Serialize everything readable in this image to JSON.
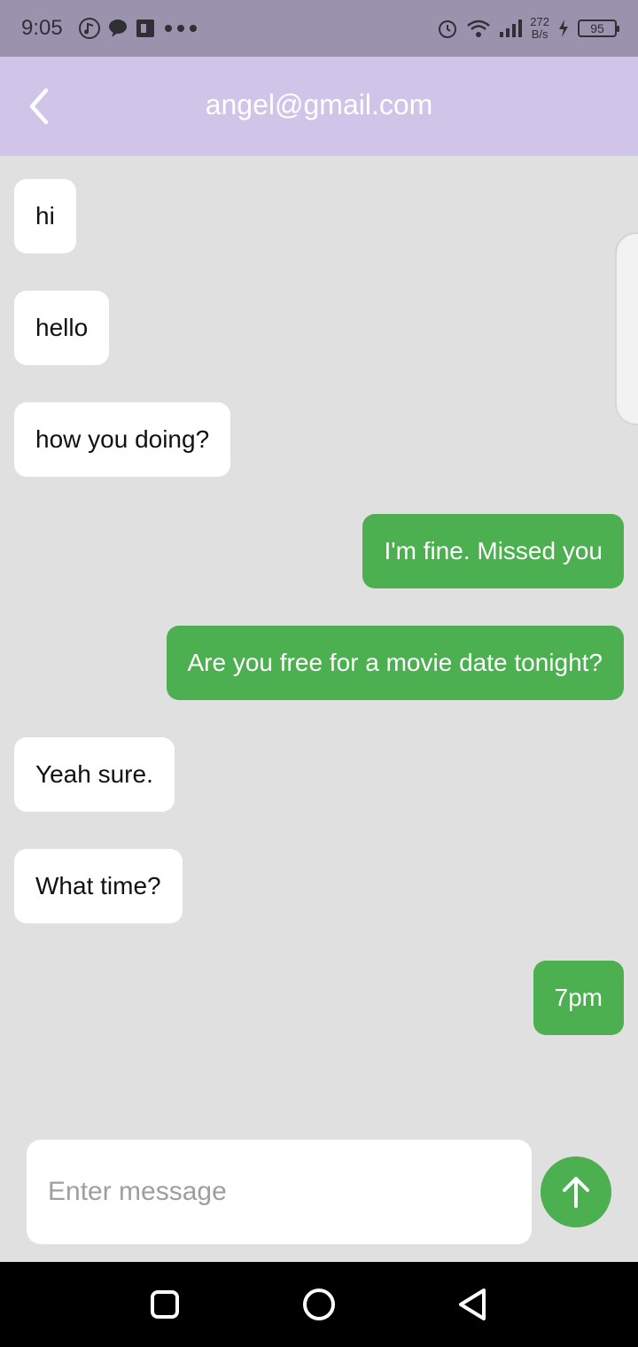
{
  "status_bar": {
    "time": "9:05",
    "net_speed_value": "272",
    "net_speed_unit": "B/s",
    "battery": "95",
    "icons_left": [
      "music-note-icon",
      "chat-bubble-icon",
      "app-icon",
      "more-dots-icon"
    ],
    "icons_right": [
      "alarm-icon",
      "wifi-icon",
      "signal-icon",
      "charging-icon",
      "battery-icon"
    ]
  },
  "app_bar": {
    "title": "angel@gmail.com",
    "back_icon": "chevron-left-icon",
    "background_color": "#d0c4e8"
  },
  "messages": [
    {
      "text": "hi",
      "from": "other"
    },
    {
      "text": "hello",
      "from": "other"
    },
    {
      "text": "how you doing?",
      "from": "other"
    },
    {
      "text": "I'm fine. Missed you",
      "from": "me"
    },
    {
      "text": "Are you free for a movie date tonight?",
      "from": "me"
    },
    {
      "text": "Yeah sure.",
      "from": "other"
    },
    {
      "text": "What time?",
      "from": "other"
    },
    {
      "text": "7pm",
      "from": "me"
    }
  ],
  "composer": {
    "placeholder": "Enter message",
    "value": "",
    "send_icon": "arrow-up-icon",
    "accent_color": "#4caf50"
  },
  "nav_bar": {
    "icons": [
      "recent-apps-icon",
      "home-icon",
      "back-icon"
    ]
  }
}
